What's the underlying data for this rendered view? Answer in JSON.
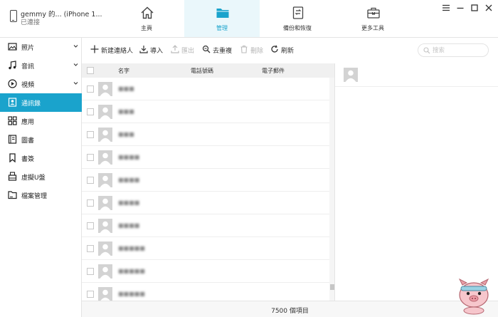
{
  "device": {
    "name": "gemmy 的... (iPhone 1...",
    "status": "已連接"
  },
  "nav_tabs": [
    {
      "label": "主頁",
      "icon": "home-icon",
      "active": false
    },
    {
      "label": "管理",
      "icon": "folder-icon",
      "active": true
    },
    {
      "label": "備份和恢復",
      "icon": "backup-restore-icon",
      "active": false
    },
    {
      "label": "更多工具",
      "icon": "toolbox-icon",
      "active": false
    }
  ],
  "window_controls": [
    "menu-icon",
    "minimize-icon",
    "maximize-icon",
    "close-icon"
  ],
  "sidebar": {
    "items": [
      {
        "label": "照片",
        "icon": "photo-icon",
        "expandable": true,
        "active": false
      },
      {
        "label": "音訊",
        "icon": "music-note-icon",
        "expandable": true,
        "active": false
      },
      {
        "label": "視頻",
        "icon": "play-circle-icon",
        "expandable": true,
        "active": false
      },
      {
        "label": "通訊錄",
        "icon": "contact-card-icon",
        "expandable": false,
        "active": true
      },
      {
        "label": "應用",
        "icon": "apps-grid-icon",
        "expandable": false,
        "active": false
      },
      {
        "label": "圖書",
        "icon": "book-icon",
        "expandable": false,
        "active": false
      },
      {
        "label": "書簽",
        "icon": "bookmark-icon",
        "expandable": false,
        "active": false
      },
      {
        "label": "虛擬U盤",
        "icon": "usb-drive-icon",
        "expandable": false,
        "active": false
      },
      {
        "label": "檔案管理",
        "icon": "file-folder-icon",
        "expandable": false,
        "active": false
      }
    ]
  },
  "toolbar": {
    "new_contact": "新建連絡人",
    "import": "導入",
    "export": "匯出",
    "dedupe": "去重複",
    "delete": "刪除",
    "refresh": "刷新",
    "search_placeholder": "搜索"
  },
  "table": {
    "columns": [
      "名字",
      "電話號碼",
      "電子郵件"
    ],
    "rows": [
      {
        "name": "■■■"
      },
      {
        "name": "■■■"
      },
      {
        "name": "■■■"
      },
      {
        "name": "■■■■"
      },
      {
        "name": "■■■■"
      },
      {
        "name": "■■■■"
      },
      {
        "name": "■■■■"
      },
      {
        "name": "■■■■■"
      },
      {
        "name": "■■■■■"
      },
      {
        "name": "■■■■■"
      }
    ]
  },
  "footer": {
    "count_text": "7500 個項目"
  },
  "colors": {
    "accent": "#1aa3cc",
    "active_tab_bg": "#eaf7fb",
    "avatar_bg": "#d3d3d3"
  }
}
